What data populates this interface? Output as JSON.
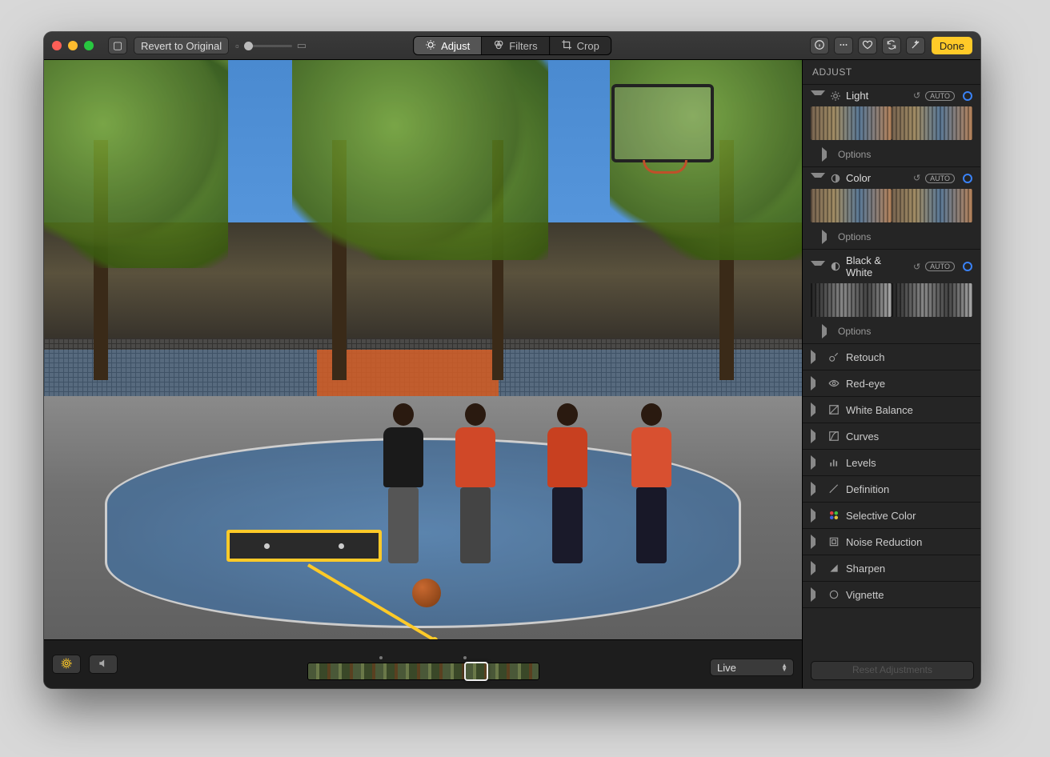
{
  "toolbar": {
    "revert_label": "Revert to Original",
    "segments": {
      "adjust": "Adjust",
      "filters": "Filters",
      "crop": "Crop"
    },
    "done_label": "Done"
  },
  "bottombar": {
    "mode_select": "Live"
  },
  "sidebar": {
    "title": "ADJUST",
    "sections": {
      "light": {
        "label": "Light",
        "auto": "AUTO",
        "options": "Options"
      },
      "color": {
        "label": "Color",
        "auto": "AUTO",
        "options": "Options"
      },
      "bw": {
        "label": "Black & White",
        "auto": "AUTO",
        "options": "Options"
      }
    },
    "simple": {
      "retouch": "Retouch",
      "redeye": "Red-eye",
      "whitebalance": "White Balance",
      "curves": "Curves",
      "levels": "Levels",
      "definition": "Definition",
      "selectivecolor": "Selective Color",
      "noisereduction": "Noise Reduction",
      "sharpen": "Sharpen",
      "vignette": "Vignette"
    },
    "reset_label": "Reset Adjustments"
  }
}
